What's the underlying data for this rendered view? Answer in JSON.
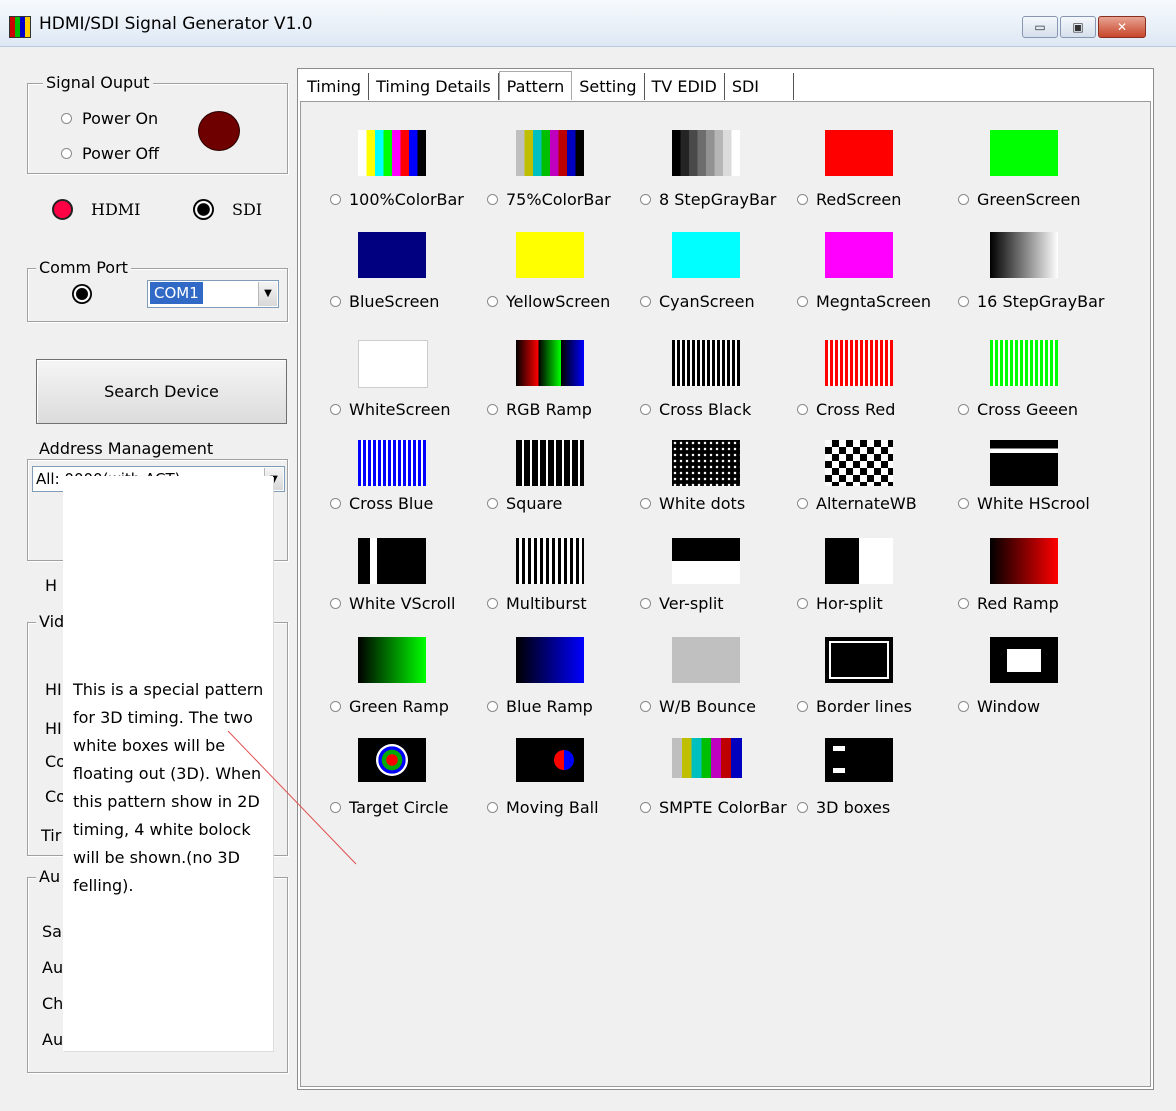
{
  "window": {
    "title": "HDMI/SDI Signal Generator V1.0",
    "min": "▭",
    "max": "▣",
    "close": "✕"
  },
  "signal_output": {
    "group_label": "Signal Ouput",
    "power_on": "Power On",
    "power_off": "Power Off",
    "led_color": "#6e0000"
  },
  "output_type": {
    "hdmi": "HDMI",
    "sdi": "SDI",
    "hdmi_color": "#ff0044"
  },
  "comm_port": {
    "group_label": "Comm Port",
    "selected": "COM1"
  },
  "search_button": "Search Device",
  "address": {
    "group_label": "Address Management",
    "selected": "All: 0000(with ACT)"
  },
  "left_obscured": {
    "h_label": "H",
    "vid_group": "Vid",
    "rows": [
      "HI",
      "HI",
      "Co",
      "Co",
      "Tir"
    ],
    "au_group": "Au",
    "au_rows": [
      "Sa",
      "Au",
      "Ch",
      "Au"
    ]
  },
  "tabs": [
    "Timing",
    "Timing Details",
    "Pattern",
    "Setting",
    "TV EDID",
    "SDI"
  ],
  "active_tab": "Pattern",
  "patterns": [
    {
      "label": "100%ColorBar",
      "icon": "colorbar-100-icon"
    },
    {
      "label": "75%ColorBar",
      "icon": "colorbar-75-icon"
    },
    {
      "label": "8 StepGrayBar",
      "icon": "gray-8-step-icon"
    },
    {
      "label": "RedScreen",
      "icon": "red-screen-icon",
      "color": "#ff0000"
    },
    {
      "label": "GreenScreen",
      "icon": "green-screen-icon",
      "color": "#00ff00"
    },
    {
      "label": "BlueScreen",
      "icon": "blue-screen-icon",
      "color": "#000080"
    },
    {
      "label": "YellowScreen",
      "icon": "yellow-screen-icon",
      "color": "#ffff00"
    },
    {
      "label": "CyanScreen",
      "icon": "cyan-screen-icon",
      "color": "#00ffff"
    },
    {
      "label": "MegntaScreen",
      "icon": "magenta-screen-icon",
      "color": "#ff00ff"
    },
    {
      "label": "16 StepGrayBar",
      "icon": "gray-16-step-icon"
    },
    {
      "label": "WhiteScreen",
      "icon": "white-screen-icon",
      "color": "#ffffff"
    },
    {
      "label": "RGB Ramp",
      "icon": "rgb-ramp-icon"
    },
    {
      "label": "Cross Black",
      "icon": "cross-black-icon"
    },
    {
      "label": "Cross Red",
      "icon": "cross-red-icon"
    },
    {
      "label": "Cross Geeen",
      "icon": "cross-green-icon"
    },
    {
      "label": "Cross Blue",
      "icon": "cross-blue-icon"
    },
    {
      "label": "Square",
      "icon": "square-grid-icon"
    },
    {
      "label": "White dots",
      "icon": "white-dots-icon"
    },
    {
      "label": "AlternateWB",
      "icon": "alternate-wb-icon"
    },
    {
      "label": "White HScrool",
      "icon": "white-hscroll-icon"
    },
    {
      "label": "White VScroll",
      "icon": "white-vscroll-icon"
    },
    {
      "label": "Multiburst",
      "icon": "multiburst-icon"
    },
    {
      "label": "Ver-split",
      "icon": "ver-split-icon"
    },
    {
      "label": "Hor-split",
      "icon": "hor-split-icon"
    },
    {
      "label": "Red Ramp",
      "icon": "red-ramp-icon"
    },
    {
      "label": "Green Ramp",
      "icon": "green-ramp-icon"
    },
    {
      "label": "Blue Ramp",
      "icon": "blue-ramp-icon"
    },
    {
      "label": "W/B Bounce",
      "icon": "wb-bounce-icon"
    },
    {
      "label": "Border lines",
      "icon": "border-lines-icon"
    },
    {
      "label": "Window",
      "icon": "window-icon"
    },
    {
      "label": "Target Circle",
      "icon": "target-circle-icon"
    },
    {
      "label": "Moving Ball",
      "icon": "moving-ball-icon"
    },
    {
      "label": "SMPTE ColorBar",
      "icon": "smpte-colorbar-icon"
    },
    {
      "label": "3D boxes",
      "icon": "3d-boxes-icon"
    }
  ],
  "tooltip": "This is a special pattern for 3D timing. The two white boxes will be floating out (3D). When this pattern show in 2D timing, 4 white bolock will be shown.(no 3D felling).",
  "annotation_line_color": "#e05050"
}
